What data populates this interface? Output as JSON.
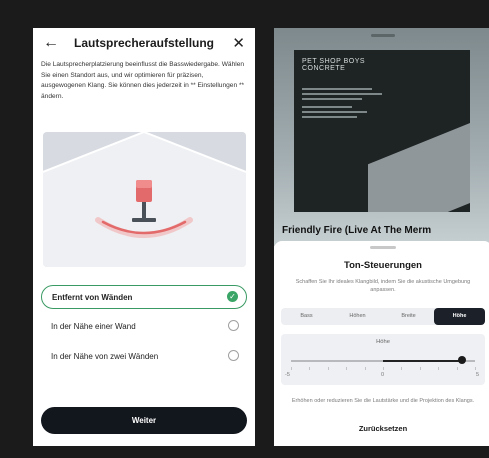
{
  "left": {
    "header": {
      "back_icon": "arrow-left-icon",
      "title": "Lautsprecheraufstellung",
      "close_icon": "close-icon"
    },
    "description": "Die Lautsprecherplatzierung beeinflusst die Basswiedergabe. Wählen Sie einen Standort aus, und wir optimieren für präzisen, ausgewogenen Klang. Sie können dies jederzeit in ** Einstellungen ** ändern.",
    "colors": {
      "accent_green": "#3aa566",
      "speaker_red": "#e36a6a",
      "button_dark": "#12161d"
    },
    "options": [
      {
        "label": "Entfernt von Wänden",
        "selected": true
      },
      {
        "label": "In der Nähe einer Wand",
        "selected": false
      },
      {
        "label": "In der Nähe von zwei Wänden",
        "selected": false
      }
    ],
    "next_label": "Weiter"
  },
  "right": {
    "album": {
      "title_line1": "PET SHOP BOYS",
      "title_line2": "CONCRETE"
    },
    "song_title": "Friendly Fire (Live At The Merm",
    "sheet": {
      "title": "Ton-Steuerungen",
      "description": "Schaffen Sie Ihr ideales Klangbild, indem Sie die akustische Umgebung anpassen.",
      "tabs": [
        "Bass",
        "Höhen",
        "Breite",
        "Höhe"
      ],
      "active_tab": "Höhe",
      "slider": {
        "title": "Höhe",
        "min_label": "-5",
        "mid_label": "0",
        "max_label": "5",
        "value": 4
      },
      "footer": "Erhöhen oder reduzieren Sie die Lautstärke und die Projektion des Klangs.",
      "reset_label": "Zurücksetzen"
    }
  }
}
